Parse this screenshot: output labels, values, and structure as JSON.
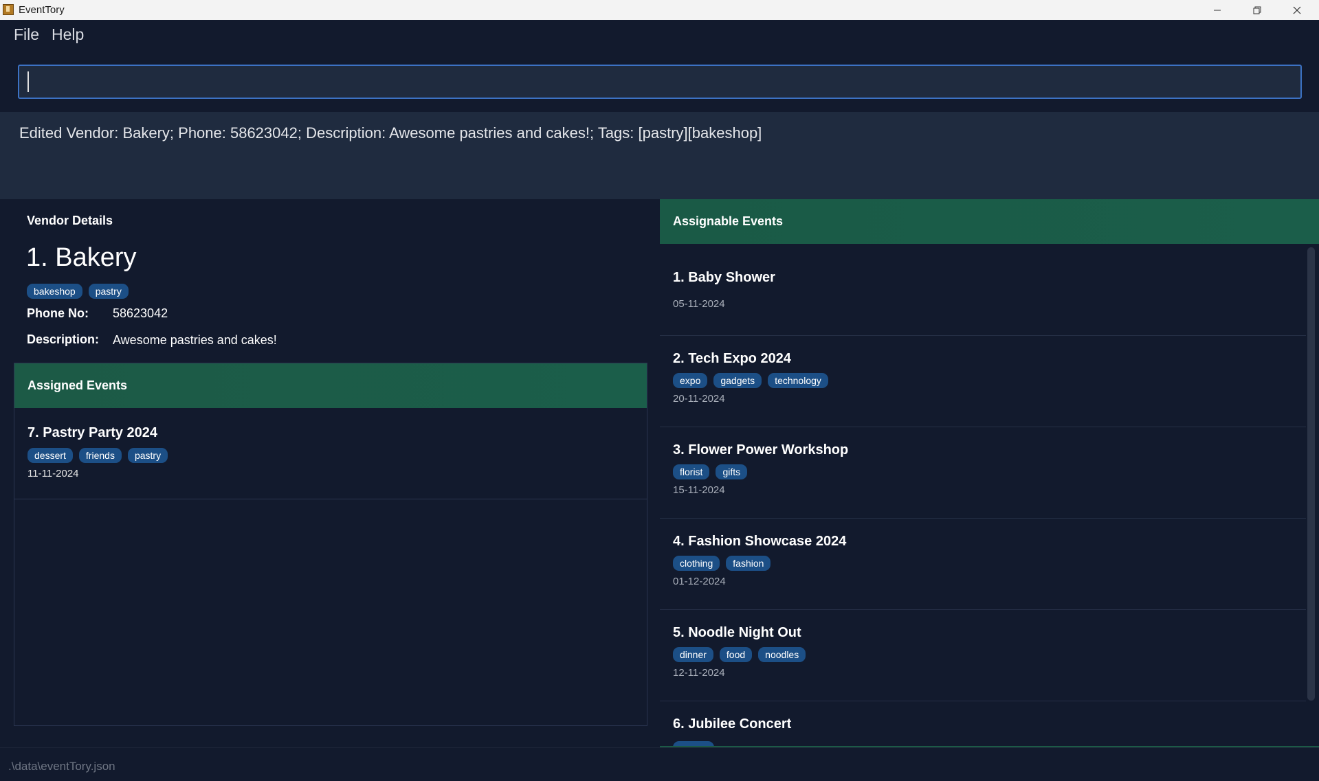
{
  "window": {
    "title": "EventTory",
    "controls": [
      "minimize",
      "restore",
      "close"
    ]
  },
  "menu": {
    "file": "File",
    "help": "Help"
  },
  "command_box": {
    "value": "",
    "placeholder": ""
  },
  "result": {
    "message": "Edited Vendor: Bakery; Phone: 58623042; Description: Awesome pastries and cakes!; Tags: [pastry][bakeshop]"
  },
  "vendor_details": {
    "heading": "Vendor Details",
    "name": "1. Bakery",
    "tags": [
      "bakeshop",
      "pastry"
    ],
    "phone_label": "Phone No:",
    "phone": "58623042",
    "description_label": "Description:",
    "description": "Awesome pastries and cakes!"
  },
  "assigned_events": {
    "heading": "Assigned Events",
    "items": [
      {
        "title": "7. Pastry Party 2024",
        "tags": [
          "dessert",
          "friends",
          "pastry"
        ],
        "date": "11-11-2024"
      }
    ]
  },
  "assignable_events": {
    "heading": "Assignable Events",
    "items": [
      {
        "title": "1. Baby Shower",
        "tags": [],
        "date": "05-11-2024"
      },
      {
        "title": "2. Tech Expo 2024",
        "tags": [
          "expo",
          "gadgets",
          "technology"
        ],
        "date": "20-11-2024"
      },
      {
        "title": "3. Flower Power Workshop",
        "tags": [
          "florist",
          "gifts"
        ],
        "date": "15-11-2024"
      },
      {
        "title": "4. Fashion Showcase 2024",
        "tags": [
          "clothing",
          "fashion"
        ],
        "date": "01-12-2024"
      },
      {
        "title": "5. Noodle Night Out",
        "tags": [
          "dinner",
          "food",
          "noodles"
        ],
        "date": "12-11-2024"
      },
      {
        "title": "6. Jubilee Concert",
        "tags": [],
        "date": ""
      }
    ]
  },
  "status": {
    "path": ".\\data\\eventTory.json"
  },
  "colors": {
    "background": "#121a2d",
    "panel": "#1f2b3f",
    "header_green": "#1b5e4a",
    "tag_blue": "#1c4f86",
    "input_border": "#3c72c4"
  }
}
